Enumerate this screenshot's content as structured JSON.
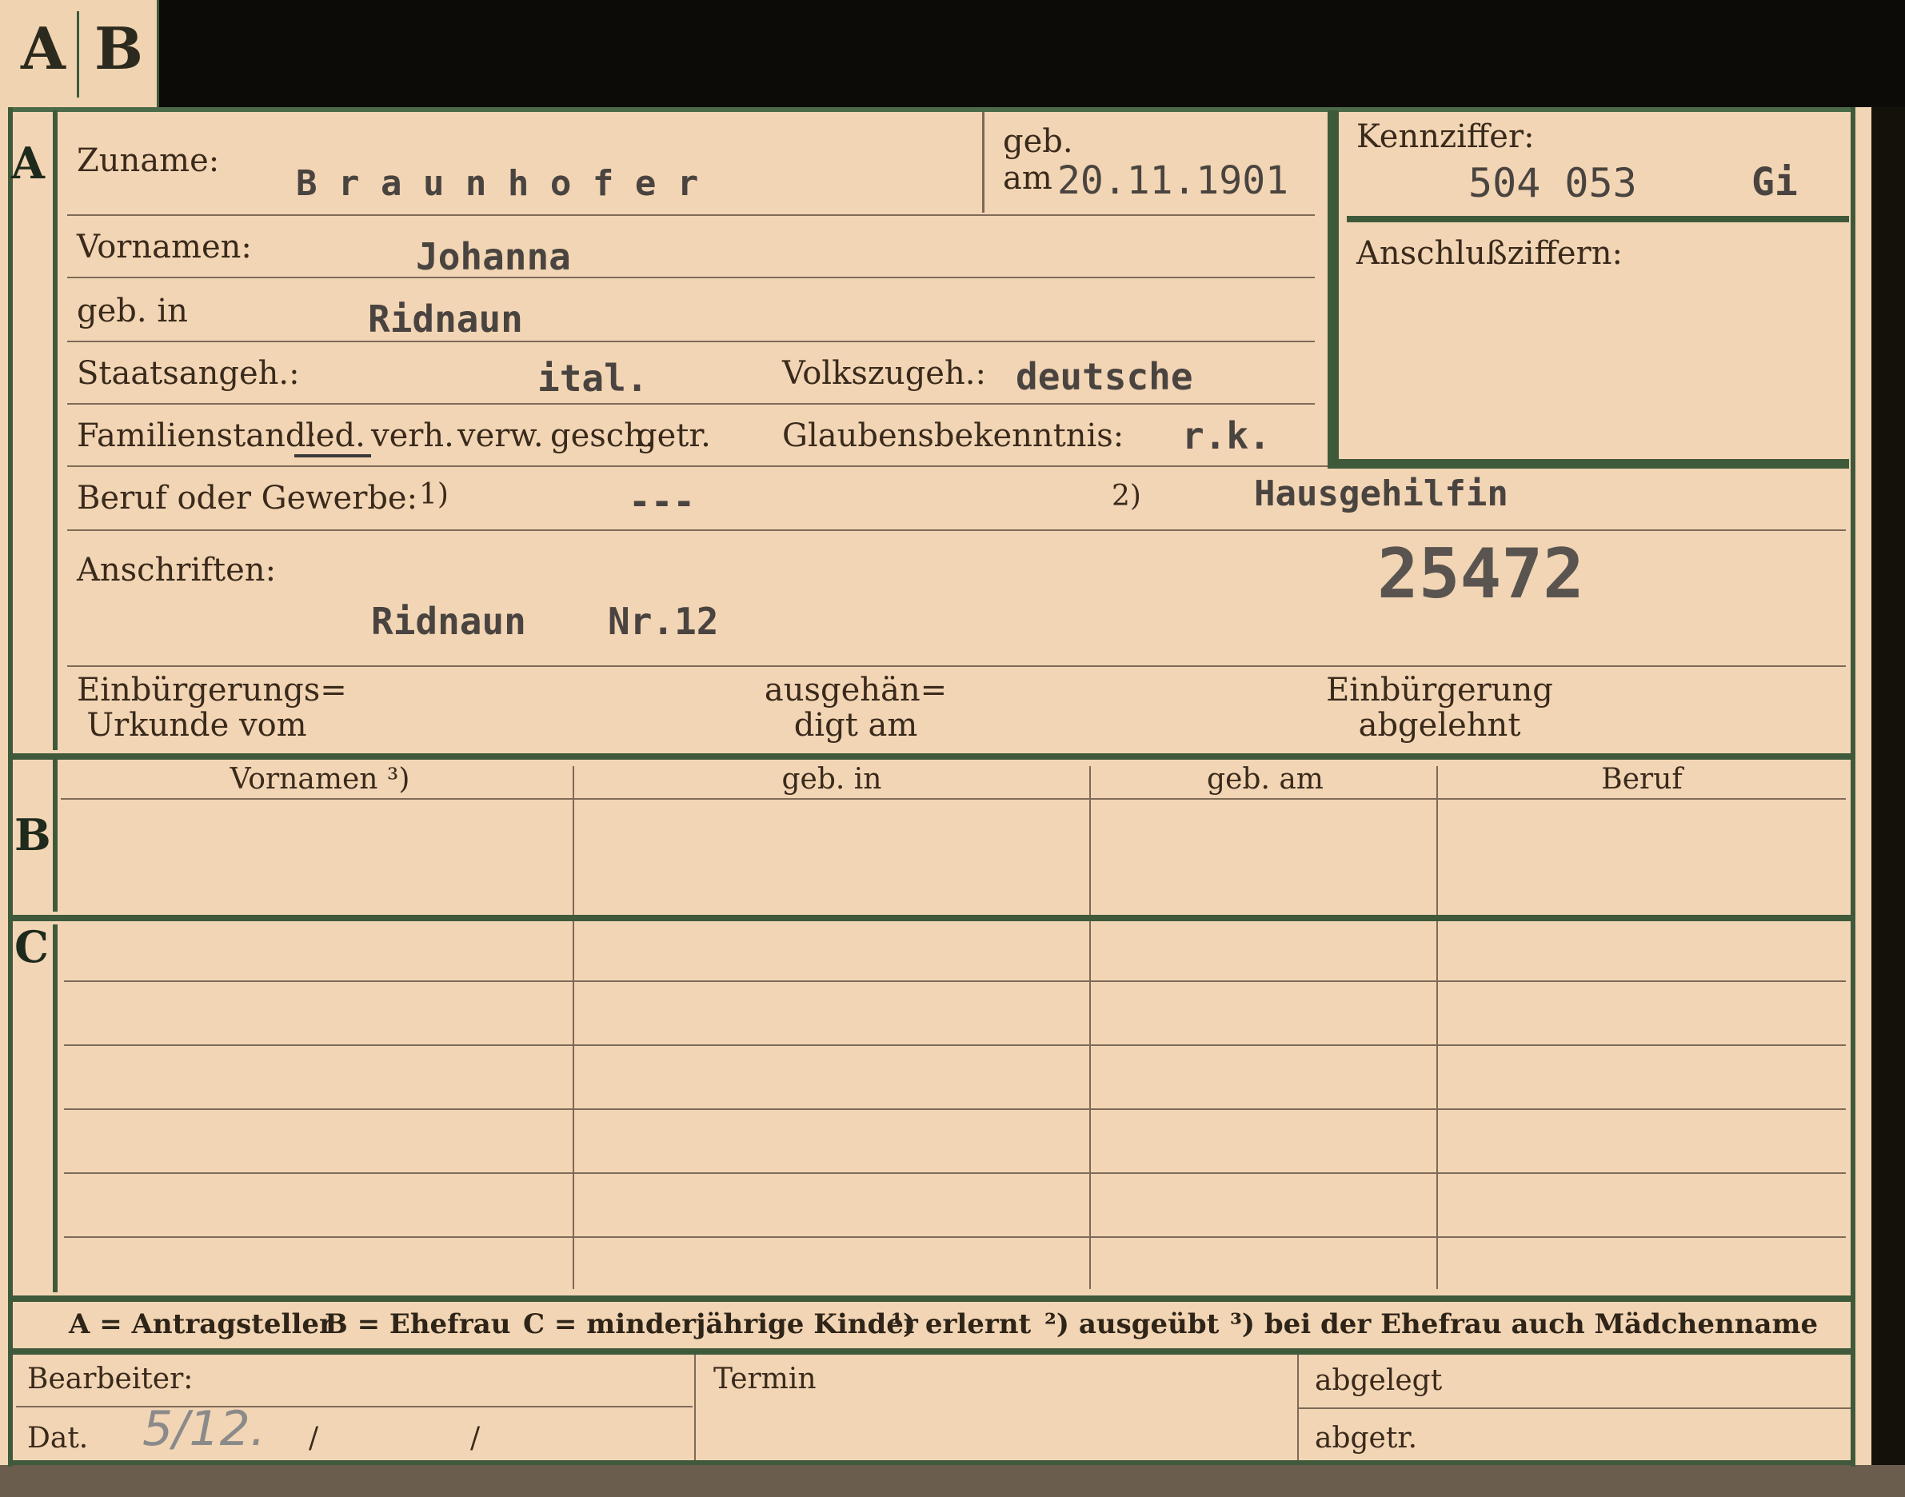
{
  "tab": {
    "a": "A",
    "b": "B"
  },
  "sections": {
    "a": "A",
    "b": "B",
    "c": "C"
  },
  "form": {
    "zuname_label": "Zuname:",
    "zuname_value": "B r a u n h o f e r",
    "geb_label": "geb.",
    "am_label": "am",
    "birth_date": "20.11.1901",
    "kennziffer_label": "Kennziffer:",
    "kennziffer_value": "504 053",
    "kennziffer_code": "Gi",
    "anschluss_label": "Anschlußziffern:",
    "vornamen_label": "Vornamen:",
    "vornamen_value": "Johanna",
    "gebin_label": "geb. in",
    "gebin_value": "Ridnaun",
    "staat_label": "Staatsangeh.:",
    "staat_value": "ital.",
    "volk_label": "Volkszugeh.:",
    "volk_value": "deutsche",
    "familien_label": "Familienstand:",
    "familien_options": [
      "led.",
      "verh.",
      "verw.",
      "gesch.",
      "getr."
    ],
    "glauben_label": "Glaubensbekenntnis:",
    "glauben_value": "r.k.",
    "beruf_label": "Beruf oder Gewerbe:",
    "beruf_mark1": "1)",
    "beruf_value1": "---",
    "beruf_mark2": "2)",
    "beruf_value2": "Hausgehilfin",
    "stamp_number": "25472",
    "anschrift_label": "Anschriften:",
    "anschrift_place": "Ridnaun",
    "anschrift_nr": "Nr.12",
    "einb_urkunde_l1": "Einbürgerungs=",
    "einb_urkunde_l2": "Urkunde vom",
    "ausgeh_l1": "ausgehän=",
    "ausgeh_l2": "digt am",
    "einb_abg_l1": "Einbürgerung",
    "einb_abg_l2": "abgelehnt"
  },
  "table": {
    "headers": [
      "Vornamen ³)",
      "geb. in",
      "geb. am",
      "Beruf"
    ]
  },
  "legend": {
    "a": "A = Antragsteller",
    "b": "B = Ehefrau",
    "c": "C = minderjährige Kinder",
    "n1": "¹) erlernt",
    "n2": "²) ausgeübt",
    "n3": "³) bei der Ehefrau auch Mädchenname"
  },
  "footer": {
    "bearbeiter": "Bearbeiter:",
    "dat": "Dat.",
    "dat_hand": "5/12.",
    "slash1": "/",
    "slash2": "/",
    "termin": "Termin",
    "abgelegt": "abgelegt",
    "abgetr": "abgetr."
  }
}
